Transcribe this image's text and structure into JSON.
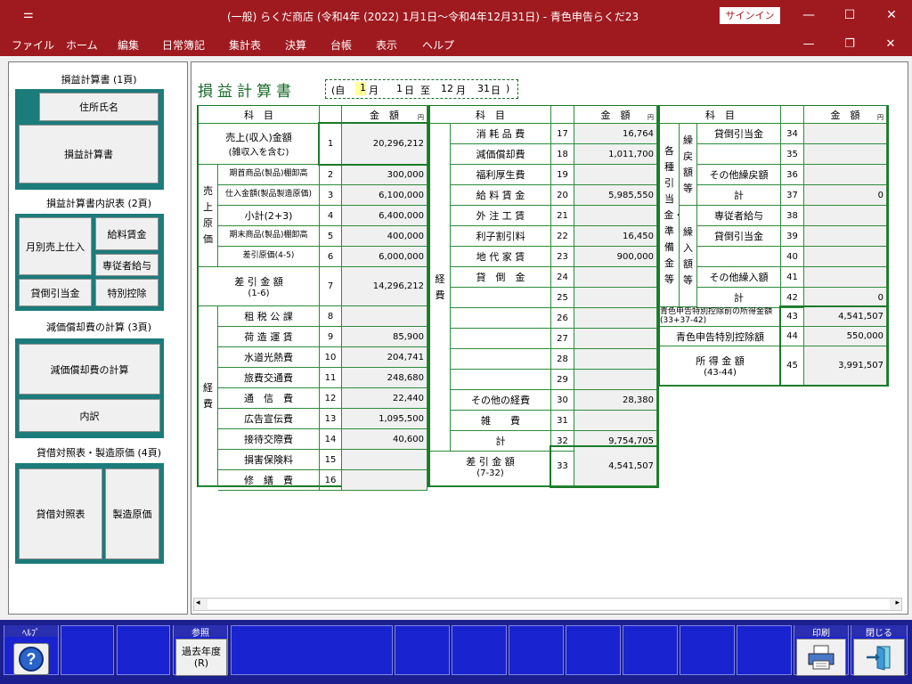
{
  "titlebar": {
    "title": "(一般) らくだ商店 (令和4年 (2022) 1月1日～令和4年12月31日)  -  青色申告らくだ23",
    "signin": "サインイン"
  },
  "menu": [
    "ファイル",
    "ホーム",
    "編集",
    "日常簿記",
    "集計表",
    "決算",
    "台帳",
    "表示",
    "ヘルプ"
  ],
  "left": {
    "sec1": "損益計算書 (1頁)",
    "btn_address": "住所氏名",
    "btn_pl": "損益計算書",
    "sec2": "損益計算書内訳表 (2頁)",
    "btn_monthly": "月別売上仕入",
    "btn_salary": "給料賃金",
    "btn_family": "専従者給与",
    "btn_bad": "貸倒引当金",
    "btn_special": "特別控除",
    "sec3": "減価償却費の計算 (3頁)",
    "btn_dep": "減価償却費の計算",
    "btn_detail": "内訳",
    "sec4": "貸借対照表・製造原価 (4頁)",
    "btn_bs": "貸借対照表",
    "btn_mfg": "製造原価"
  },
  "heading": "損益計算書",
  "period": {
    "open": "(自",
    "month_from": "1",
    "m1": "月",
    "day_from": "1",
    "d1": "日",
    "to": "至",
    "month_to": "12",
    "m2": "月",
    "day_to": "31",
    "d2": "日",
    "close": ")"
  },
  "headers": {
    "item": "科　目",
    "amount": "金　額",
    "yen": "円"
  },
  "groups": {
    "cost": "売上原価",
    "exp1": "経費",
    "exp2": "経費",
    "reserve": "各種引当金・準備金等",
    "reversal": "繰戻額等",
    "transfer": "繰入額等"
  },
  "col1": [
    {
      "label": "売上(収入)金額",
      "sub": "(雑収入を含む)",
      "no": "1",
      "amt": "20,296,212"
    },
    {
      "label": "期首商品(製品)棚卸高",
      "no": "2",
      "amt": "300,000"
    },
    {
      "label": "仕入金額(製品製造原価)",
      "no": "3",
      "amt": "6,100,000"
    },
    {
      "label": "小計(2+3)",
      "no": "4",
      "amt": "6,400,000"
    },
    {
      "label": "期末商品(製品)棚卸高",
      "no": "5",
      "amt": "400,000"
    },
    {
      "label": "差引原価(4-5)",
      "no": "6",
      "amt": "6,000,000"
    },
    {
      "label": "差 引 金 額",
      "sub": "(1-6)",
      "no": "7",
      "amt": "14,296,212"
    },
    {
      "label": "租 税 公 課",
      "no": "8",
      "amt": ""
    },
    {
      "label": "荷 造 運 賃",
      "no": "9",
      "amt": "85,900"
    },
    {
      "label": "水道光熱費",
      "no": "10",
      "amt": "204,741"
    },
    {
      "label": "旅費交通費",
      "no": "11",
      "amt": "248,680"
    },
    {
      "label": "通　信　費",
      "no": "12",
      "amt": "22,440"
    },
    {
      "label": "広告宣伝費",
      "no": "13",
      "amt": "1,095,500"
    },
    {
      "label": "接待交際費",
      "no": "14",
      "amt": "40,600"
    },
    {
      "label": "損害保険料",
      "no": "15",
      "amt": ""
    },
    {
      "label": "修　繕　費",
      "no": "16",
      "amt": ""
    }
  ],
  "col2": [
    {
      "label": "消 耗 品 費",
      "no": "17",
      "amt": "16,764"
    },
    {
      "label": "減価償却費",
      "no": "18",
      "amt": "1,011,700"
    },
    {
      "label": "福利厚生費",
      "no": "19",
      "amt": ""
    },
    {
      "label": "給 料 賃 金",
      "no": "20",
      "amt": "5,985,550"
    },
    {
      "label": "外 注 工 賃",
      "no": "21",
      "amt": ""
    },
    {
      "label": "利子割引料",
      "no": "22",
      "amt": "16,450"
    },
    {
      "label": "地 代 家 賃",
      "no": "23",
      "amt": "900,000"
    },
    {
      "label": "貸　倒　金",
      "no": "24",
      "amt": ""
    },
    {
      "label": "",
      "no": "25",
      "amt": ""
    },
    {
      "label": "",
      "no": "26",
      "amt": ""
    },
    {
      "label": "",
      "no": "27",
      "amt": ""
    },
    {
      "label": "",
      "no": "28",
      "amt": ""
    },
    {
      "label": "",
      "no": "29",
      "amt": ""
    },
    {
      "label": "その他の経費",
      "no": "30",
      "amt": "28,380"
    },
    {
      "label": "雑　　費",
      "no": "31",
      "amt": ""
    },
    {
      "label": "計",
      "no": "32",
      "amt": "9,754,705"
    },
    {
      "label": "差 引 金 額",
      "sub": "(7-32)",
      "no": "33",
      "amt": "4,541,507"
    }
  ],
  "col3": [
    {
      "label": "貸倒引当金",
      "no": "34",
      "amt": ""
    },
    {
      "label": "",
      "no": "35",
      "amt": ""
    },
    {
      "label": "その他繰戻額",
      "no": "36",
      "amt": ""
    },
    {
      "label": "計",
      "no": "37",
      "amt": "0"
    },
    {
      "label": "専従者給与",
      "no": "38",
      "amt": ""
    },
    {
      "label": "貸倒引当金",
      "no": "39",
      "amt": ""
    },
    {
      "label": "",
      "no": "40",
      "amt": ""
    },
    {
      "label": "その他繰入額",
      "no": "41",
      "amt": ""
    },
    {
      "label": "計",
      "no": "42",
      "amt": "0"
    },
    {
      "label": "青色申告特別控除前の所得金額(33+37-42)",
      "no": "43",
      "amt": "4,541,507"
    },
    {
      "label": "青色申告特別控除額",
      "no": "44",
      "amt": "550,000"
    },
    {
      "label": "所 得 金 額",
      "sub": "(43-44)",
      "no": "45",
      "amt": "3,991,507"
    }
  ],
  "fkeys": {
    "help_label": "ﾍﾙﾌﾟ",
    "ref_label": "参照",
    "prev_year": "過去年度",
    "prev_key": "(R)",
    "print_label": "印刷",
    "close_label": "閉じる"
  },
  "colors": {
    "title": "#9f1a1f",
    "green": "#1a7a2a",
    "fkbar": "#1b1f8f",
    "teal": "#1c7b7b"
  }
}
